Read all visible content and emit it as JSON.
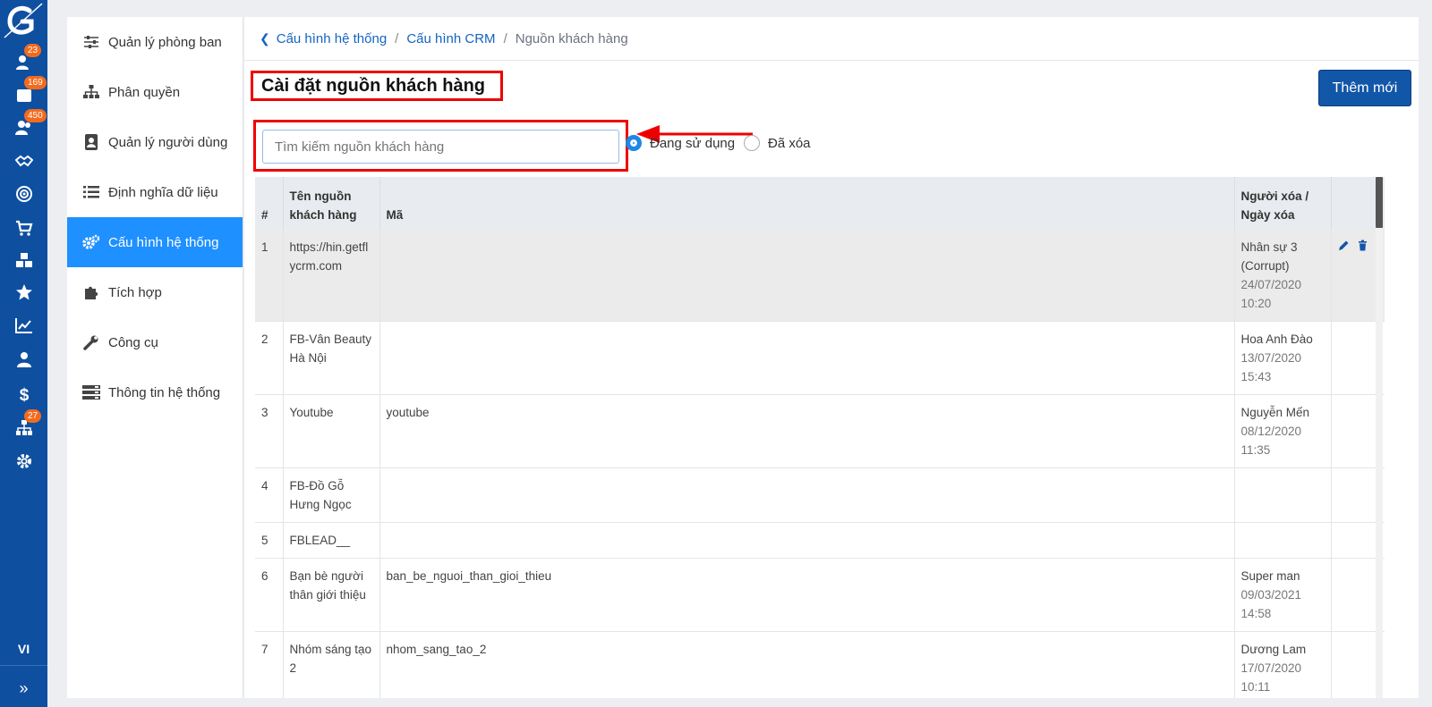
{
  "rail": {
    "lang": "VI",
    "badges": {
      "b1": "23",
      "b2": "169",
      "b3": "450",
      "b4": "27"
    }
  },
  "sidebar": {
    "items": [
      {
        "label": "Quản lý phòng ban",
        "icon": "sliders-icon"
      },
      {
        "label": "Phân quyền",
        "icon": "sitemap-icon"
      },
      {
        "label": "Quản lý người dùng",
        "icon": "address-book-icon"
      },
      {
        "label": "Định nghĩa dữ liệu",
        "icon": "list-icon"
      },
      {
        "label": "Cấu hình hệ thống",
        "icon": "cogs-icon",
        "active": true
      },
      {
        "label": "Tích hợp",
        "icon": "puzzle-icon"
      },
      {
        "label": "Công cụ",
        "icon": "wrench-icon"
      },
      {
        "label": "Thông tin hệ thống",
        "icon": "server-icon"
      }
    ]
  },
  "breadcrumb": {
    "item1": "Cấu hình hệ thống",
    "item2": "Cấu hình CRM",
    "current": "Nguồn khách hàng",
    "sep": "/"
  },
  "page": {
    "title": "Cài đặt nguồn khách hàng",
    "add_label": "Thêm mới"
  },
  "search": {
    "placeholder": "Tìm kiếm nguồn khách hàng"
  },
  "filter": {
    "active_label": "Đang sử dụng",
    "deleted_label": "Đã xóa",
    "selected": "active"
  },
  "table": {
    "headers": {
      "num": "#",
      "name": "Tên nguồn khách hàng",
      "code": "Mã",
      "deleted": "Người xóa / Ngày xóa"
    },
    "rows": [
      {
        "num": "1",
        "name": "https://hin.getflycrm.com",
        "code": "",
        "person": "Nhân sự 3 (Corrupt)",
        "date": "24/07/2020",
        "time": "10:20"
      },
      {
        "num": "2",
        "name": "FB-Vân Beauty Hà Nội",
        "code": "",
        "person": "Hoa Anh Đào",
        "date": "13/07/2020",
        "time": "15:43"
      },
      {
        "num": "3",
        "name": "Youtube",
        "code": "youtube",
        "person": "Nguyễn Mến",
        "date": "08/12/2020",
        "time": "11:35"
      },
      {
        "num": "4",
        "name": "FB-Đồ Gỗ Hưng Ngọc",
        "code": "",
        "person": "",
        "date": "",
        "time": ""
      },
      {
        "num": "5",
        "name": "FBLEAD__",
        "code": "",
        "person": "",
        "date": "",
        "time": ""
      },
      {
        "num": "6",
        "name": "Bạn bè người thân giới thiệu",
        "code": "ban_be_nguoi_than_gioi_thieu",
        "person": "Super man",
        "date": "09/03/2021",
        "time": "14:58"
      },
      {
        "num": "7",
        "name": "Nhóm sáng tạo 2",
        "code": "nhom_sang_tao_2",
        "person": "Dương Lam",
        "date": "17/07/2020",
        "time": "10:11"
      }
    ]
  },
  "colors": {
    "rail": "#0f4fa0",
    "active": "#1e90ff",
    "button": "#1256a8",
    "highlight": "#e00000",
    "badge": "#f26b1d"
  }
}
